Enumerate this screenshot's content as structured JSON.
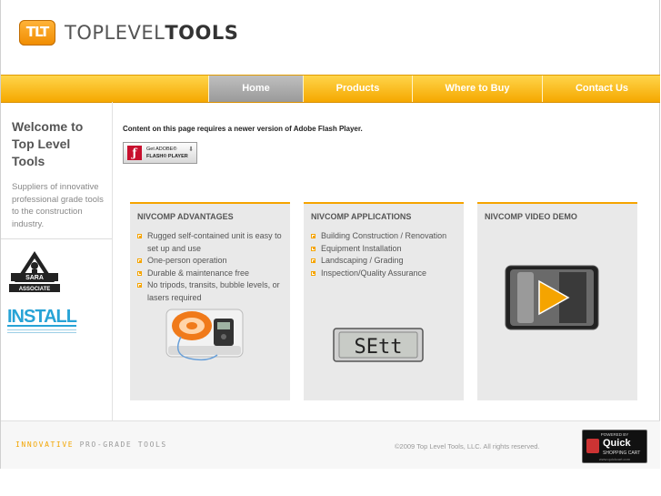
{
  "header": {
    "logo_mark": "TLT",
    "logo_text_light": "TOPLEVEL",
    "logo_text_bold": "TOOLS"
  },
  "nav": {
    "items": [
      {
        "label": "Home",
        "active": true
      },
      {
        "label": "Products"
      },
      {
        "label": "Where to Buy"
      },
      {
        "label": "Contact Us"
      }
    ]
  },
  "sidebar": {
    "welcome": "Welcome to Top Level Tools",
    "tagline": "Suppliers of innovative professional grade tools to the construction industry."
  },
  "flash": {
    "message": "Content on this page requires a newer version of Adobe Flash Player.",
    "button_line1": "Get ADOBE®",
    "button_line2": "FLASH® PLAYER"
  },
  "panels": [
    {
      "title": "NIVCOMP ADVANTAGES",
      "items": [
        "Rugged self-contained unit is easy to set up and use",
        "One-person operation",
        "Durable & maintenance free",
        "No tripods, transits, bubble levels, or lasers required"
      ]
    },
    {
      "title": "NIVCOMP APPLICATIONS",
      "items": [
        "Building Construction / Renovation",
        "Equipment Installation",
        "Landscaping / Grading",
        "Inspection/Quality Assurance"
      ]
    },
    {
      "title": "NIVCOMP VIDEO DEMO",
      "items": []
    }
  ],
  "gauge_display": "SEtt",
  "footer": {
    "slogan_part1": "INNOVATIVE",
    "slogan_part2": "PRO-GRADE TOOLS",
    "copyright": "©2009 Top Level Tools, LLC. All rights reserved.",
    "badge_powered": "POWERED BY",
    "badge_quick": "Quick",
    "badge_cart": "SHOPPING CART",
    "badge_url": "www.quickcart.com"
  },
  "colors": {
    "accent": "#f5a400",
    "nav_active": "#a8a8a8"
  }
}
